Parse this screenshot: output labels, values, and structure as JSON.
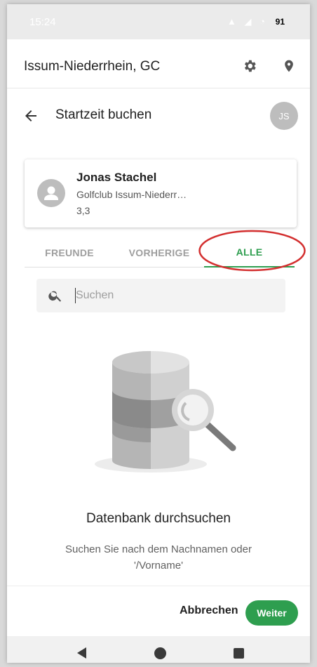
{
  "status_bar": {
    "time": "15:24",
    "battery": "91"
  },
  "app_bar": {
    "title": "Issum-Niederrhein, GC",
    "settings_icon": "gear-icon",
    "location_icon": "map-marker-icon"
  },
  "header": {
    "title": "Startzeit buchen",
    "back_icon": "arrow-left-icon",
    "user_initials": "JS"
  },
  "player": {
    "name": "Jonas Stachel",
    "club": "Golfclub Issum-Niederr…",
    "handicap": "3,3"
  },
  "tabs": [
    {
      "label": "FREUNDE",
      "active": false
    },
    {
      "label": "VORHERIGE",
      "active": false
    },
    {
      "label": "ALLE",
      "active": true
    }
  ],
  "search": {
    "placeholder": "Suchen",
    "value": ""
  },
  "empty_state": {
    "title": "Datenbank durchsuchen",
    "text": "Suchen Sie nach dem Nachnamen oder '/Vorname'"
  },
  "actions": {
    "cancel_label": "Abbrechen",
    "continue_label": "Weiter"
  },
  "colors": {
    "accent": "#2e9e4f",
    "annotation": "#d32f2f",
    "avatar_bg": "#bdbdbd"
  }
}
